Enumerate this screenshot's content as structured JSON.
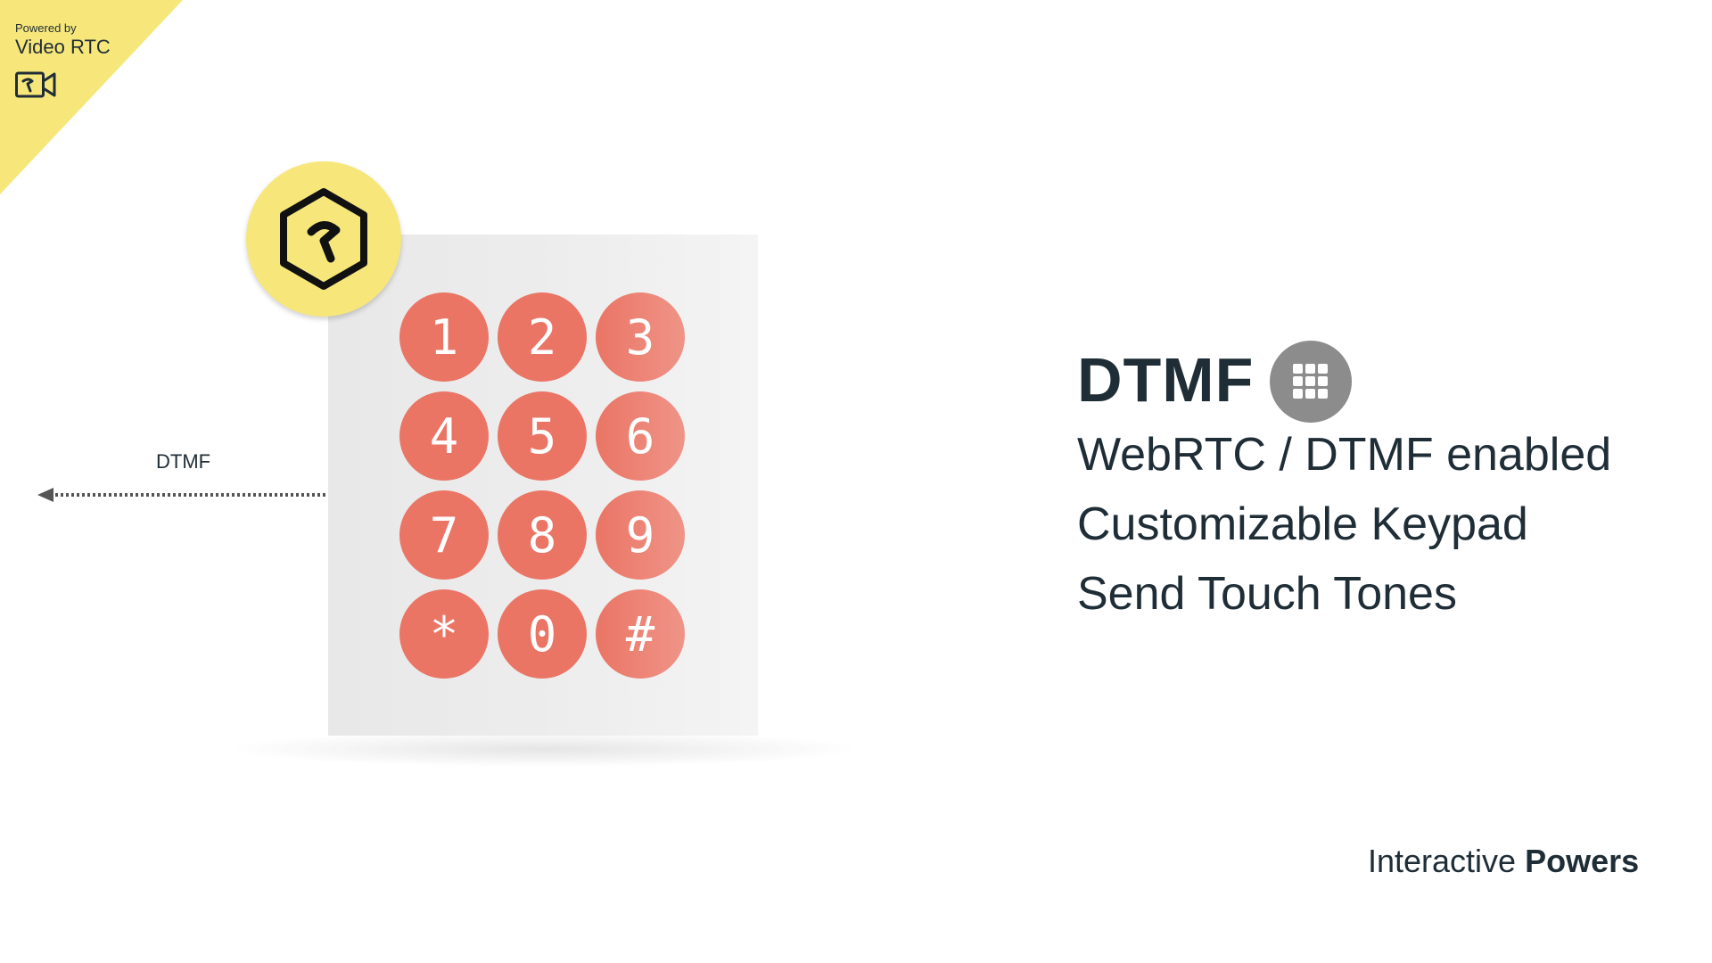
{
  "corner": {
    "powered_by": "Powered by",
    "brand": "Video RTC",
    "brand_icon": "video-camera-icon"
  },
  "badge": {
    "icon": "hexagon-logo-icon"
  },
  "arrow": {
    "label": "DTMF"
  },
  "keypad": {
    "keys": [
      "1",
      "2",
      "3",
      "4",
      "5",
      "6",
      "7",
      "8",
      "9",
      "*",
      "0",
      "#"
    ]
  },
  "content": {
    "title": "DTMF",
    "title_icon": "keypad-grid-icon",
    "features": [
      "WebRTC / DTMF enabled",
      "Customizable Keypad",
      "Send Touch Tones"
    ]
  },
  "footer": {
    "prefix": "Interactive",
    "bold": "Powers"
  },
  "colors": {
    "accent_yellow": "#f7e77a",
    "key_coral": "#ea7565",
    "text_dark": "#1f2d36",
    "icon_gray": "#8c8c8c"
  }
}
